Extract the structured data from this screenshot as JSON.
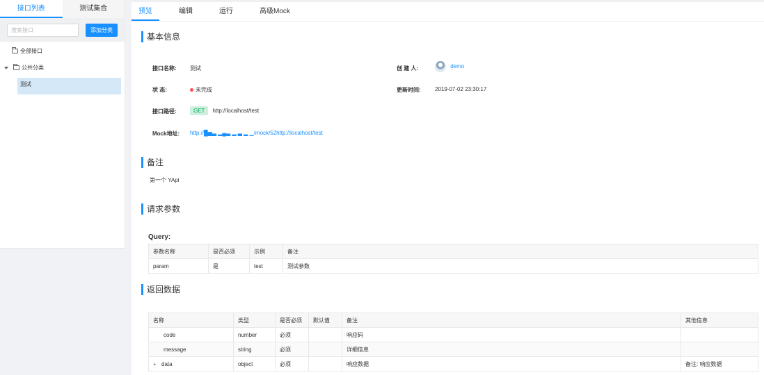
{
  "sidebar": {
    "tabs": [
      "接口列表",
      "测试集合"
    ],
    "search_placeholder": "搜索接口",
    "add_category_label": "添加分类",
    "tree": {
      "all": "全部接口",
      "category": "公共分类",
      "selected": "测试"
    }
  },
  "main": {
    "tabs": [
      "预览",
      "编辑",
      "运行",
      "高级Mock"
    ],
    "basic_info": {
      "title": "基本信息",
      "name_label": "接口名称:",
      "name_value": "测试",
      "creator_label": "创 建 人:",
      "creator_value": "demo",
      "status_label": "状 态:",
      "status_value": "未完成",
      "updated_label": "更新时间:",
      "updated_value": "2019-07-02 23:30:17",
      "path_label": "接口路径:",
      "method": "GET",
      "path_value": "http://localhost/test",
      "mock_label": "Mock地址:",
      "mock_value": "http://█▅▃ ▂▄▃ ▂.▃ ▂ ▁/mock/52http://localhost/test"
    },
    "remark": {
      "title": "备注",
      "text": "第一个 YApi"
    },
    "request": {
      "title": "请求参数",
      "query_label": "Query:",
      "headers": [
        "参数名称",
        "是否必须",
        "示例",
        "备注"
      ],
      "rows": [
        [
          "param",
          "是",
          "test",
          "测试参数"
        ]
      ]
    },
    "response": {
      "title": "返回数据",
      "headers": [
        "名称",
        "类型",
        "是否必须",
        "默认值",
        "备注",
        "其他信息"
      ],
      "rows": [
        [
          "code",
          "number",
          "必须",
          "",
          "响应码",
          ""
        ],
        [
          "message",
          "string",
          "必须",
          "",
          "详细信息",
          ""
        ],
        [
          "data",
          "object",
          "必须",
          "",
          "响应数据",
          "备注: 响应数据"
        ]
      ],
      "expand_symbol": "+"
    }
  }
}
